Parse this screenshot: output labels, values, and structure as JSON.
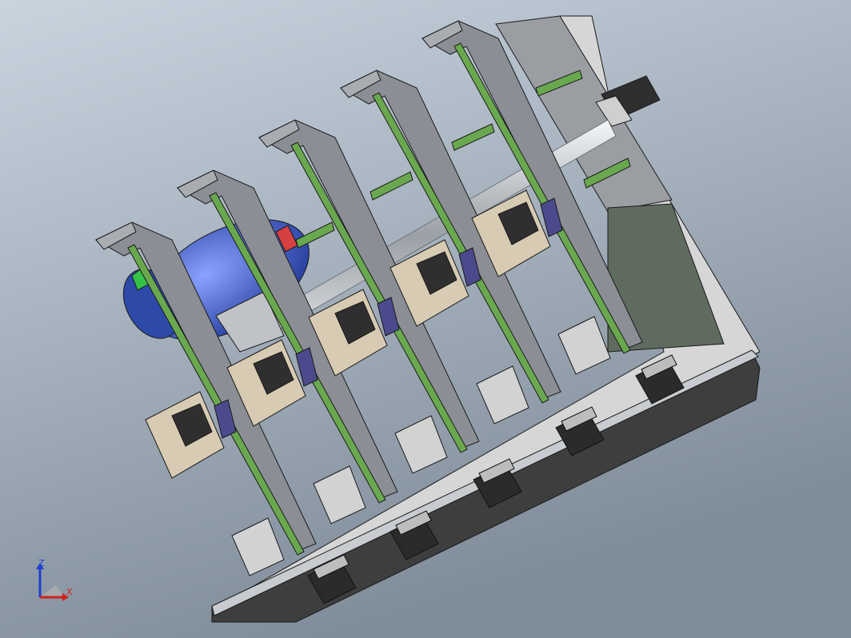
{
  "scene": {
    "subject": "cad-assembly",
    "background_top": "#c9d4df",
    "background_bottom": "#7f8c99",
    "colors": {
      "base_plate": "#3e3e3e",
      "base_top": "#d6d6d6",
      "frame": "#8b8f95",
      "frame_light": "#a9adb2",
      "guide_rail": "#6aa84f",
      "motor_mount": "#d8cbb3",
      "stepper": "#2f2f2f",
      "coupling": "#4a4a8c",
      "rod": "#d0d4d8",
      "spindle_motor": "#3c5fc8",
      "edge": "#1a1a1a"
    },
    "axis_units_count": 5
  },
  "triad": {
    "z_label": "Z",
    "x_label": "X",
    "z_color": "#1f3fd0",
    "x_color": "#d02020",
    "y_color": "#20a020"
  }
}
